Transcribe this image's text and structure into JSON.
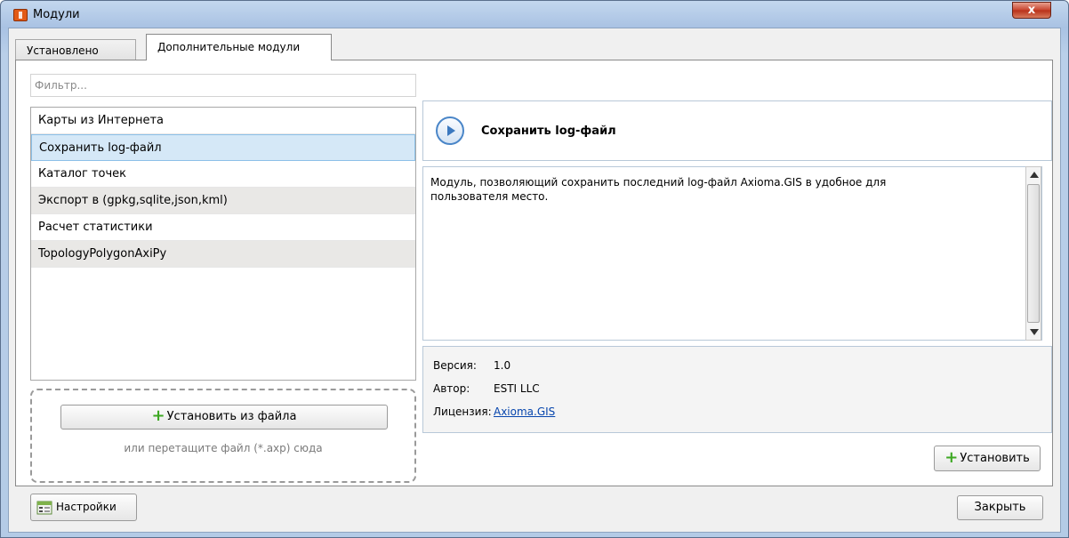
{
  "window": {
    "title": "Модули",
    "close_symbol": "x"
  },
  "tabs": [
    {
      "label": "Установлено",
      "active": false
    },
    {
      "label": "Дополнительные модули",
      "active": true
    }
  ],
  "filter": {
    "placeholder": "Фильтр..."
  },
  "modules": [
    {
      "label": "Карты из Интернета",
      "selected": false
    },
    {
      "label": "Сохранить log-файл",
      "selected": true
    },
    {
      "label": "Каталог точек",
      "selected": false
    },
    {
      "label": "Экспорт в (gpkg,sqlite,json,kml)",
      "selected": false
    },
    {
      "label": "Расчет статистики",
      "selected": false
    },
    {
      "label": "TopologyPolygonAxiPy",
      "selected": false
    }
  ],
  "dropzone": {
    "install_label": "Установить из файла",
    "hint": "или перетащите файл (*.axp) сюда"
  },
  "detail": {
    "title": "Сохранить log-файл",
    "description": "Модуль, позволяющий сохранить последний log-файл Axioma.GIS в удобное для пользователя место.",
    "version_label": "Версия:",
    "version": "1.0",
    "author_label": "Автор:",
    "author": "ESTI LLC",
    "license_label": "Лицензия:",
    "license": "Axioma.GIS"
  },
  "buttons": {
    "install": "Установить",
    "settings": "Настройки",
    "close": "Закрыть"
  },
  "colors": {
    "accent_plus": "#3da823",
    "selection": "#d5e8f7",
    "link": "#0645ad"
  }
}
